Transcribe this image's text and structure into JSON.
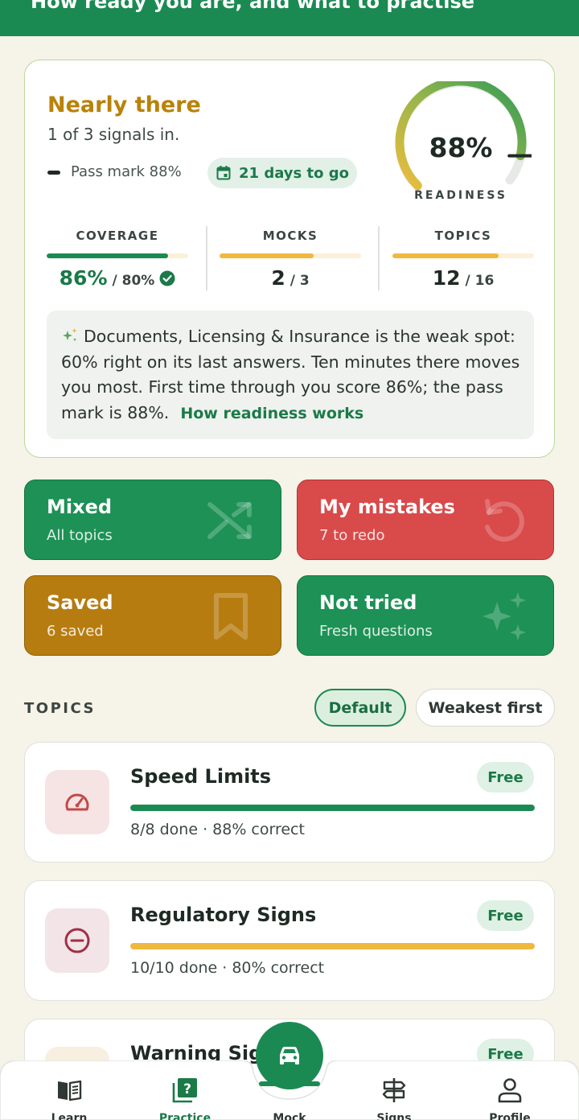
{
  "header": {
    "subtitle": "How ready you are, and what to practise"
  },
  "readiness": {
    "status_title": "Nearly there",
    "status_sub": "1 of 3 signals in.",
    "pass_mark": "Pass mark 88%",
    "days_chip": "21 days to go",
    "gauge_value": "88%",
    "gauge_fraction": 0.88,
    "gauge_label": "READINESS",
    "metrics": [
      {
        "label": "COVERAGE",
        "value": "86%",
        "target": "/ 80%",
        "fill": 0.86
      },
      {
        "label": "MOCKS",
        "value": "2",
        "target": "/ 3",
        "fill": 0.667
      },
      {
        "label": "TOPICS",
        "value": "12",
        "target": "/ 16",
        "fill": 0.75
      }
    ],
    "insight": "Documents, Licensing & Insurance is the weak spot: 60% right on its last answers. Ten minutes there moves you most. First time through you score 86%; the pass mark is 88%.",
    "insight_link": "How readiness works"
  },
  "modes": {
    "mixed": {
      "title": "Mixed",
      "sub": "All topics"
    },
    "mistakes": {
      "title": "My mistakes",
      "sub": "7 to redo"
    },
    "saved": {
      "title": "Saved",
      "sub": "6 saved"
    },
    "not_tried": {
      "title": "Not tried",
      "sub": "Fresh questions"
    }
  },
  "topics": {
    "heading": "TOPICS",
    "sort_default": "Default",
    "sort_weakest": "Weakest first",
    "items": [
      {
        "title": "Speed Limits",
        "badge": "Free",
        "progress": 1.0,
        "stats": "8/8 done · 88% correct",
        "bar_color": "#1b8a52",
        "icon": "speedometer-icon"
      },
      {
        "title": "Regulatory Signs",
        "badge": "Free",
        "progress": 1.0,
        "stats": "10/10 done · 80% correct",
        "bar_color": "#f0b83e",
        "icon": "no-entry-icon"
      },
      {
        "title": "Warning Signs",
        "badge": "Free",
        "progress": 0.0,
        "stats": "",
        "bar_color": "#1b8a52",
        "icon": "warning-icon"
      }
    ]
  },
  "nav": {
    "learn": "Learn",
    "practice": "Practice",
    "mock": "Mock",
    "signs": "Signs",
    "profile": "Profile"
  },
  "colors": {
    "brand_green": "#1b8a52",
    "amber": "#b98209",
    "red": "#d94a4a",
    "gold_tile": "#b67c10",
    "page_bg": "#f6f3e8"
  }
}
